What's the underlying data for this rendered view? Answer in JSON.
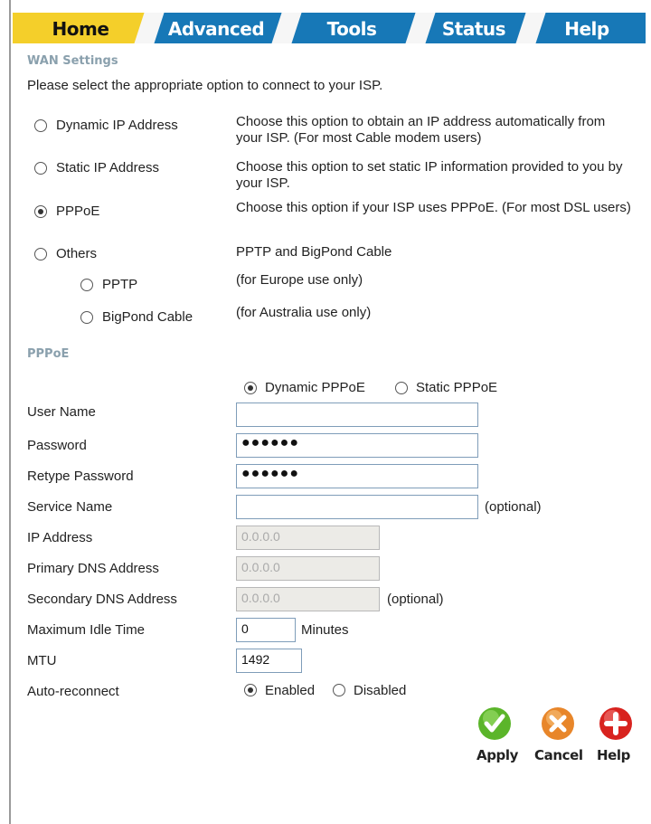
{
  "tabs": [
    {
      "label": "Home",
      "active": true
    },
    {
      "label": "Advanced",
      "active": false
    },
    {
      "label": "Tools",
      "active": false
    },
    {
      "label": "Status",
      "active": false
    },
    {
      "label": "Help",
      "active": false
    }
  ],
  "wan": {
    "title": "WAN Settings",
    "intro": "Please select the appropriate option to connect to your ISP.",
    "options": [
      {
        "label": "Dynamic IP Address",
        "desc": "Choose this option to obtain an IP address automatically from your ISP. (For most Cable modem users)",
        "selected": false
      },
      {
        "label": "Static IP Address",
        "desc": "Choose this option to set static IP information provided to you by your ISP.",
        "selected": false
      },
      {
        "label": "PPPoE",
        "desc": "Choose this option if your ISP uses PPPoE. (For most DSL users)",
        "selected": true
      },
      {
        "label": "Others",
        "desc": "PPTP and BigPond Cable",
        "selected": false
      },
      {
        "label": "PPTP",
        "desc": "(for Europe use only)",
        "selected": false
      },
      {
        "label": "BigPond Cable",
        "desc": "(for Australia use only)",
        "selected": false
      }
    ]
  },
  "pppoe": {
    "title": "PPPoE",
    "mode": {
      "dynamic_label": "Dynamic PPPoE",
      "static_label": "Static PPPoE",
      "selected": "dynamic"
    },
    "labels": {
      "user_name": "User Name",
      "password": "Password",
      "retype_password": "Retype Password",
      "service_name": "Service Name",
      "ip_address": "IP Address",
      "primary_dns": "Primary DNS Address",
      "secondary_dns": "Secondary DNS Address",
      "max_idle": "Maximum Idle Time",
      "mtu": "MTU",
      "auto_reconnect": "Auto-reconnect"
    },
    "values": {
      "user_name": "",
      "password": "●●●●●●",
      "retype_password": "●●●●●●",
      "service_name": "",
      "ip_address": "0.0.0.0",
      "primary_dns": "0.0.0.0",
      "secondary_dns": "0.0.0.0",
      "max_idle": "0",
      "mtu": "1492"
    },
    "optional": "(optional)",
    "minutes": "Minutes",
    "auto_reconnect": {
      "enabled_label": "Enabled",
      "disabled_label": "Disabled",
      "selected": "enabled"
    }
  },
  "actions": {
    "apply": {
      "label": "Apply",
      "icon": "check-icon",
      "color": "#5bb52a"
    },
    "cancel": {
      "label": "Cancel",
      "icon": "x-icon",
      "color": "#e8862a"
    },
    "help": {
      "label": "Help",
      "icon": "plus-icon",
      "color": "#d8231f"
    }
  }
}
